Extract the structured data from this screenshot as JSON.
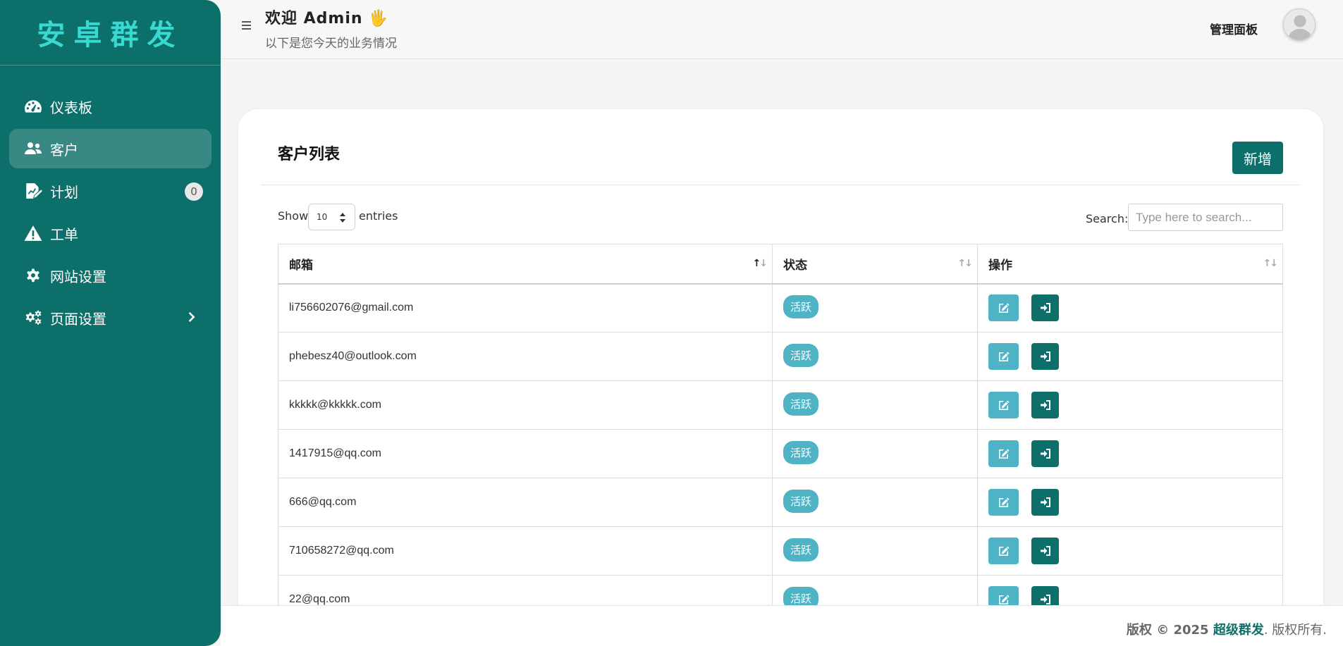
{
  "sidebar": {
    "brand": "安卓群发",
    "items": [
      {
        "label": "仪表板",
        "icon": "gauge-icon"
      },
      {
        "label": "客户",
        "icon": "users-icon",
        "active": true
      },
      {
        "label": "计划",
        "icon": "plan-icon",
        "badge": "0"
      },
      {
        "label": "工单",
        "icon": "warning-icon"
      },
      {
        "label": "网站设置",
        "icon": "gear-icon"
      },
      {
        "label": "页面设置",
        "icon": "gears-icon",
        "chevron": "chevron-right-icon"
      }
    ]
  },
  "header": {
    "welcome": "欢迎 Admin",
    "wave": "🖐",
    "subtitle": "以下是您今天的业务情况",
    "admin_panel": "管理面板"
  },
  "card": {
    "title": "客户列表",
    "add_label": "新增",
    "show_label": "Show",
    "entries_value": "10",
    "entries_label": "entries",
    "search_label": "Search:",
    "search_placeholder": "Type here to search..."
  },
  "table": {
    "columns": [
      "邮箱",
      "状态",
      "操作"
    ],
    "rows": [
      {
        "email": "li756602076@gmail.com",
        "status": "活跃"
      },
      {
        "email": "phebesz40@outlook.com",
        "status": "活跃"
      },
      {
        "email": "kkkkk@kkkkk.com",
        "status": "活跃"
      },
      {
        "email": "1417915@qq.com",
        "status": "活跃"
      },
      {
        "email": "666@qq.com",
        "status": "活跃"
      },
      {
        "email": "710658272@qq.com",
        "status": "活跃"
      },
      {
        "email": "22@qq.com",
        "status": "活跃"
      }
    ]
  },
  "footer": {
    "prefix": "版权 © 2025 ",
    "brand": "超级群发",
    "suffix": ". 版权所有."
  },
  "colors": {
    "primary": "#0d6f6a",
    "brand_text": "#38d9d1",
    "info": "#4fb3c6"
  }
}
